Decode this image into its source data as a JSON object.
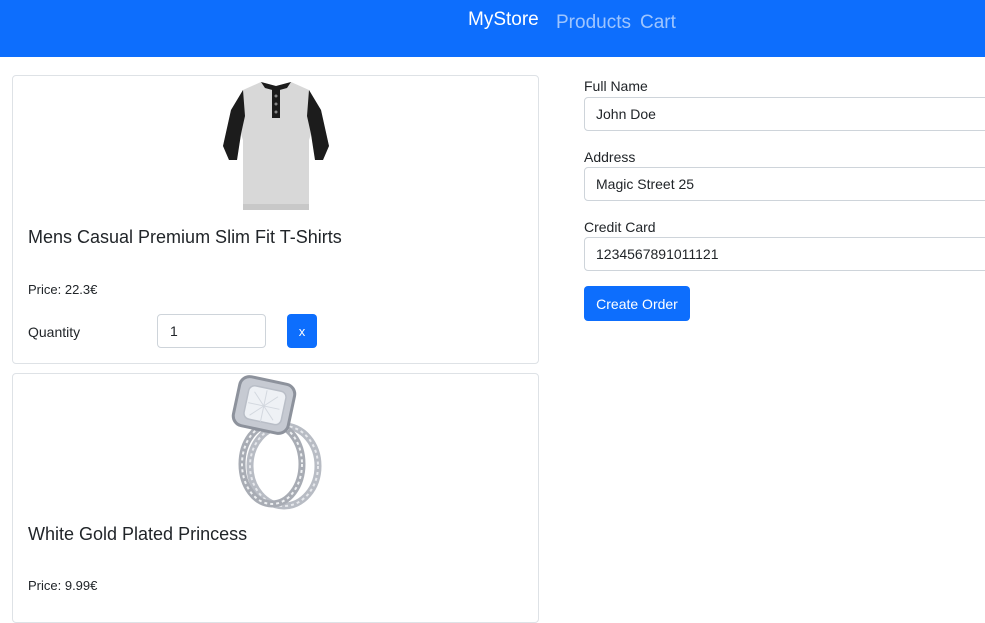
{
  "navbar": {
    "brand": "MyStore",
    "links": [
      "Products",
      "Cart"
    ]
  },
  "cart": {
    "items": [
      {
        "image": "black-white-henley-tshirt",
        "title": "Mens Casual Premium Slim Fit T-Shirts",
        "price": "Price: 22.3€",
        "quantity_label": "Quantity",
        "quantity": "1",
        "remove_label": "x"
      },
      {
        "image": "diamond-ring",
        "title": "White Gold Plated Princess",
        "price": "Price: 9.99€"
      }
    ]
  },
  "checkout": {
    "full_name_label": "Full Name",
    "full_name": "John Doe",
    "address_label": "Address",
    "address": "Magic Street 25",
    "credit_card_label": "Credit Card",
    "credit_card": "1234567891011121",
    "submit_label": "Create Order"
  },
  "colors": {
    "primary": "#0d6efd",
    "border": "#dee2e6",
    "text": "#212529"
  }
}
